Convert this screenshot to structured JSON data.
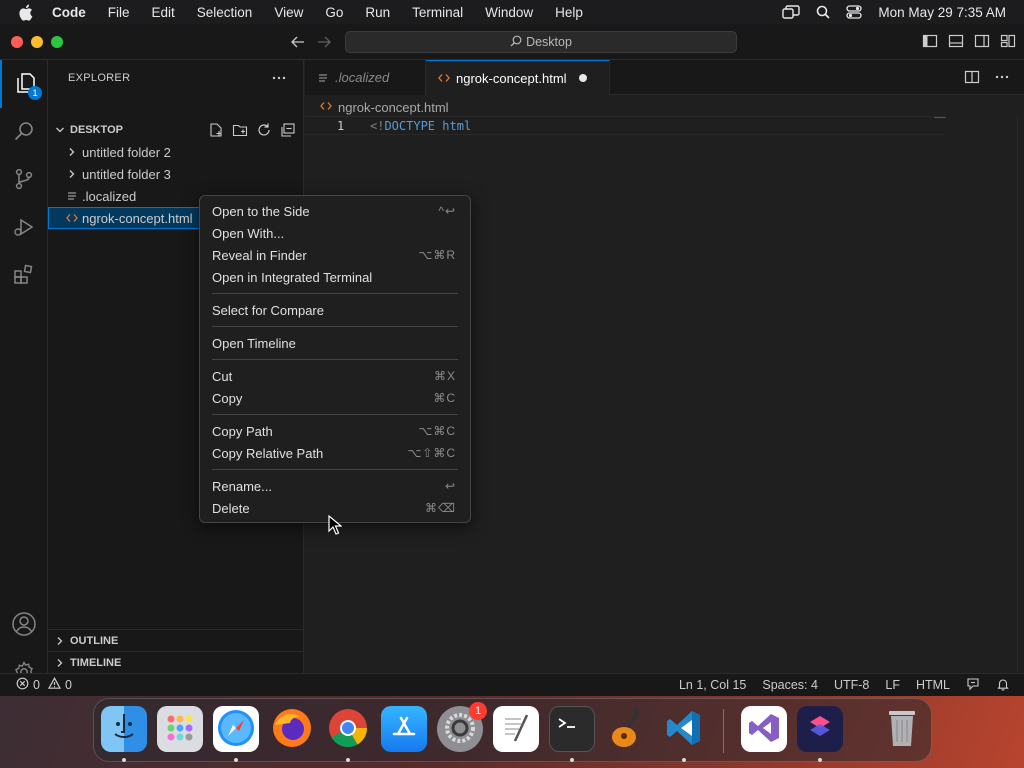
{
  "menubar": {
    "app_name": "Code",
    "items": [
      "File",
      "Edit",
      "Selection",
      "View",
      "Go",
      "Run",
      "Terminal",
      "Window",
      "Help"
    ],
    "clock": "Mon May 29  7:35 AM"
  },
  "titlebar": {
    "search_label": "Desktop"
  },
  "activity": {
    "explorer_badge": "1"
  },
  "sidebar": {
    "title": "EXPLORER",
    "folder": "DESKTOP",
    "items": [
      {
        "label": "untitled folder 2",
        "kind": "folder"
      },
      {
        "label": "untitled folder 3",
        "kind": "folder"
      },
      {
        "label": ".localized",
        "kind": "text-file"
      },
      {
        "label": "ngrok-concept.html",
        "kind": "html-file"
      }
    ],
    "outline": "OUTLINE",
    "timeline": "TIMELINE"
  },
  "tabs": [
    {
      "label": ".localized"
    },
    {
      "label": "ngrok-concept.html"
    }
  ],
  "breadcrumb": "ngrok-concept.html",
  "editor": {
    "line_number": "1",
    "punct": "<!",
    "keyword_doctype": "DOCTYPE",
    "keyword_html": "html"
  },
  "context_menu": {
    "groups": [
      [
        {
          "label": "Open to the Side",
          "shortcut": "^↩"
        },
        {
          "label": "Open With...",
          "shortcut": ""
        },
        {
          "label": "Reveal in Finder",
          "shortcut": "⌥⌘R"
        },
        {
          "label": "Open in Integrated Terminal",
          "shortcut": ""
        }
      ],
      [
        {
          "label": "Select for Compare",
          "shortcut": ""
        }
      ],
      [
        {
          "label": "Open Timeline",
          "shortcut": ""
        }
      ],
      [
        {
          "label": "Cut",
          "shortcut": "⌘X"
        },
        {
          "label": "Copy",
          "shortcut": "⌘C"
        }
      ],
      [
        {
          "label": "Copy Path",
          "shortcut": "⌥⌘C"
        },
        {
          "label": "Copy Relative Path",
          "shortcut": "⌥⇧⌘C"
        }
      ],
      [
        {
          "label": "Rename...",
          "shortcut": "↩"
        },
        {
          "label": "Delete",
          "shortcut": "⌘⌫"
        }
      ]
    ]
  },
  "statusbar": {
    "errors": "0",
    "warnings": "0",
    "position": "Ln 1, Col 15",
    "spaces": "Spaces: 4",
    "encoding": "UTF-8",
    "eol": "LF",
    "language": "HTML"
  },
  "dock": {
    "apps": [
      "finder-icon",
      "launchpad-icon",
      "safari-icon",
      "firefox-icon",
      "chrome-icon",
      "app-store-icon",
      "system-settings-icon",
      "textedit-icon",
      "terminal-icon",
      "garageband-icon",
      "vscode-icon",
      "visual-studio-icon",
      "shortcuts-icon",
      "trash-icon"
    ],
    "settings_badge": "1"
  },
  "colors": {
    "accent": "#0078d4",
    "selection": "#04395e",
    "keyword": "#569cd6"
  }
}
